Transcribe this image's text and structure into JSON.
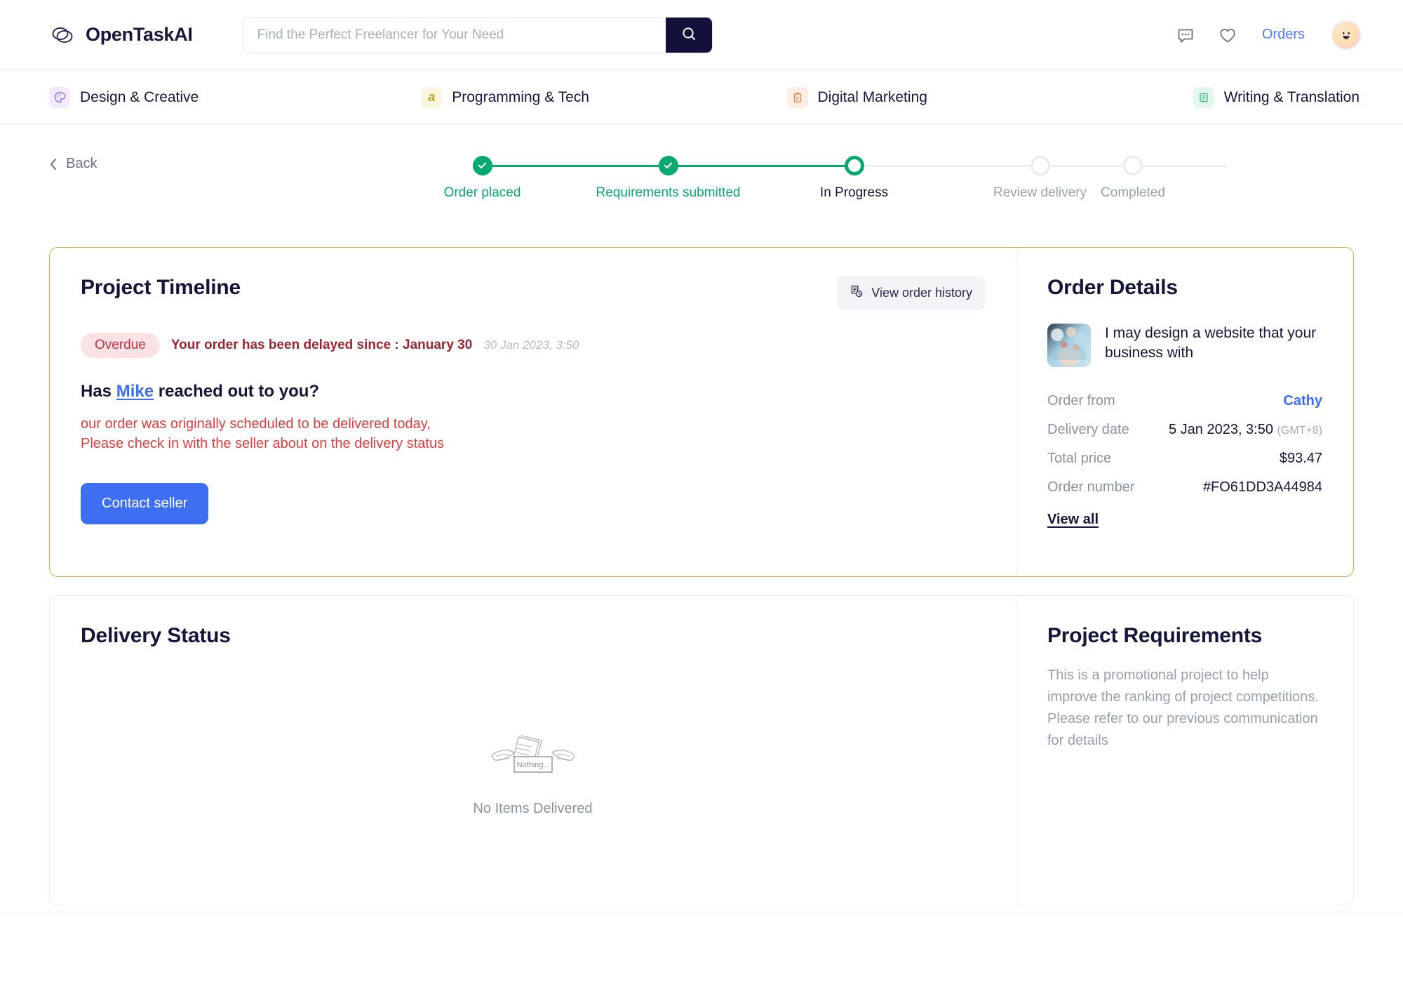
{
  "header": {
    "brand": "OpenTaskAI",
    "brand_icon": "opentask-logo-icon",
    "search": {
      "placeholder": "Find the Perfect Freelancer for Your Need",
      "value": "",
      "button_icon": "search-icon"
    },
    "messages_icon": "chat-bubble-icon",
    "favorites_icon": "heart-icon",
    "orders_label": "Orders",
    "avatar_icon": "smiley-avatar-icon"
  },
  "categories": [
    {
      "label": "Design & Creative",
      "icon": "palette-icon",
      "glyph": "◑",
      "bg": "#f1ebfd",
      "fg": "#8b5cf6"
    },
    {
      "label": "Programming & Tech",
      "icon": "code-icon",
      "glyph": "a",
      "bg": "#fbf6e1",
      "fg": "#c9a227"
    },
    {
      "label": "Digital Marketing",
      "icon": "megaphone-icon",
      "glyph": "ὌB",
      "bg": "#fdeee4",
      "fg": "#f0803c"
    },
    {
      "label": "Writing & Translation",
      "icon": "document-icon",
      "glyph": "≡",
      "bg": "#e4f7ee",
      "fg": "#2bb673"
    }
  ],
  "nav": {
    "back_label": "Back",
    "back_icon": "chevron-left-icon"
  },
  "stepper": {
    "steps": [
      {
        "label": "Order placed",
        "state": "done"
      },
      {
        "label": "Requirements submitted",
        "state": "done"
      },
      {
        "label": "In Progress",
        "state": "current"
      },
      {
        "label": "Review delivery",
        "state": "todo"
      },
      {
        "label": "Completed",
        "state": "todo"
      }
    ],
    "accent_color": "#06a96e"
  },
  "timeline": {
    "title": "Project Timeline",
    "history_button": "View order history",
    "history_icon": "order-history-icon",
    "badge": "Overdue",
    "delay_text": "Your order has been delayed since : January 30",
    "delay_timestamp": "30 Jan 2023, 3:50",
    "question_prefix": "Has ",
    "question_link": "Mike",
    "question_suffix": " reached out to you?",
    "warning_line1": "our order was originally scheduled to be delivered today,",
    "warning_line2": "Please check in with the seller about on the delivery status",
    "contact_button": "Contact seller",
    "border_color": "#dcab4b",
    "warning_color": "#e23b3b"
  },
  "order_details": {
    "title": "Order Details",
    "thumbnail_icon": "order-thumbnail-image",
    "item_title": "I may design a website that your business with",
    "rows": [
      {
        "key": "Order from",
        "value": "Cathy",
        "type": "link"
      },
      {
        "key": "Delivery date",
        "value": "5 Jan 2023, 3:50",
        "suffix": "(GMT+8)",
        "type": "text"
      },
      {
        "key": "Total price",
        "value": "$93.47",
        "type": "text"
      },
      {
        "key": "Order number",
        "value": "#FO61DD3A44984",
        "type": "text"
      }
    ],
    "view_all": "View all",
    "link_color": "#3b6ef6"
  },
  "delivery": {
    "title": "Delivery Status",
    "empty_icon": "no-items-illustration",
    "empty_box_label": "Nothing...",
    "empty_text": "No Items Delivered"
  },
  "requirements": {
    "title": "Project Requirements",
    "body": "This is a promotional project to help improve the ranking of project competitions. Please refer to our previous communication for details"
  }
}
